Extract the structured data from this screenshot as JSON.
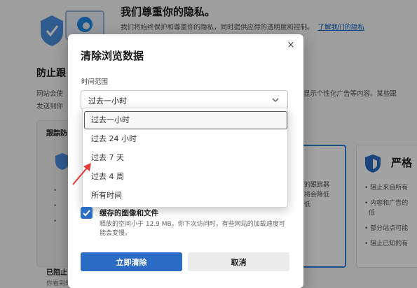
{
  "background": {
    "privacy_title": "我们尊重你的隐私。",
    "privacy_subtitle": "我们将始终保护和尊重你的隐私，同时提供应得的透明度和控制。",
    "privacy_link": "了解我们的隐私",
    "tracking_title": "防止跟",
    "tracking_desc_line1": "网站会使",
    "tracking_desc_line2": "发送到你",
    "tracking_desc_right": "显示个性化广告等内容。某些跟",
    "card_left_title": "跟踪防",
    "card_mid_lines": [
      "的跟踪器",
      "将会降低",
      "低"
    ],
    "card_right_title": "严格",
    "card_right_bullets": [
      "阻止来自所有",
      "内容和广告的",
      "低",
      "部分站点可能",
      "阻止已知的有"
    ],
    "blocked_title": "已阻止",
    "blocked_desc": "你看到的"
  },
  "dialog": {
    "title": "清除浏览数据",
    "close_label": "×",
    "time_range_label": "时间范围",
    "selected_value": "过去一小时",
    "options": [
      "过去一小时",
      "过去 24 小时",
      "过去 7 天",
      "过去 4 周",
      "所有时间"
    ],
    "checkbox_label": "缓存的图像和文件",
    "checkbox_desc": "释放的空间小于 12.9 MB。你下次访问时，有些网站的加载速度可能会变慢。",
    "clear_button": "立即清除",
    "cancel_button": "取消",
    "checkbox_checked": true
  },
  "colors": {
    "accent": "#2b6cc4",
    "annotation_arrow": "#e53935"
  }
}
